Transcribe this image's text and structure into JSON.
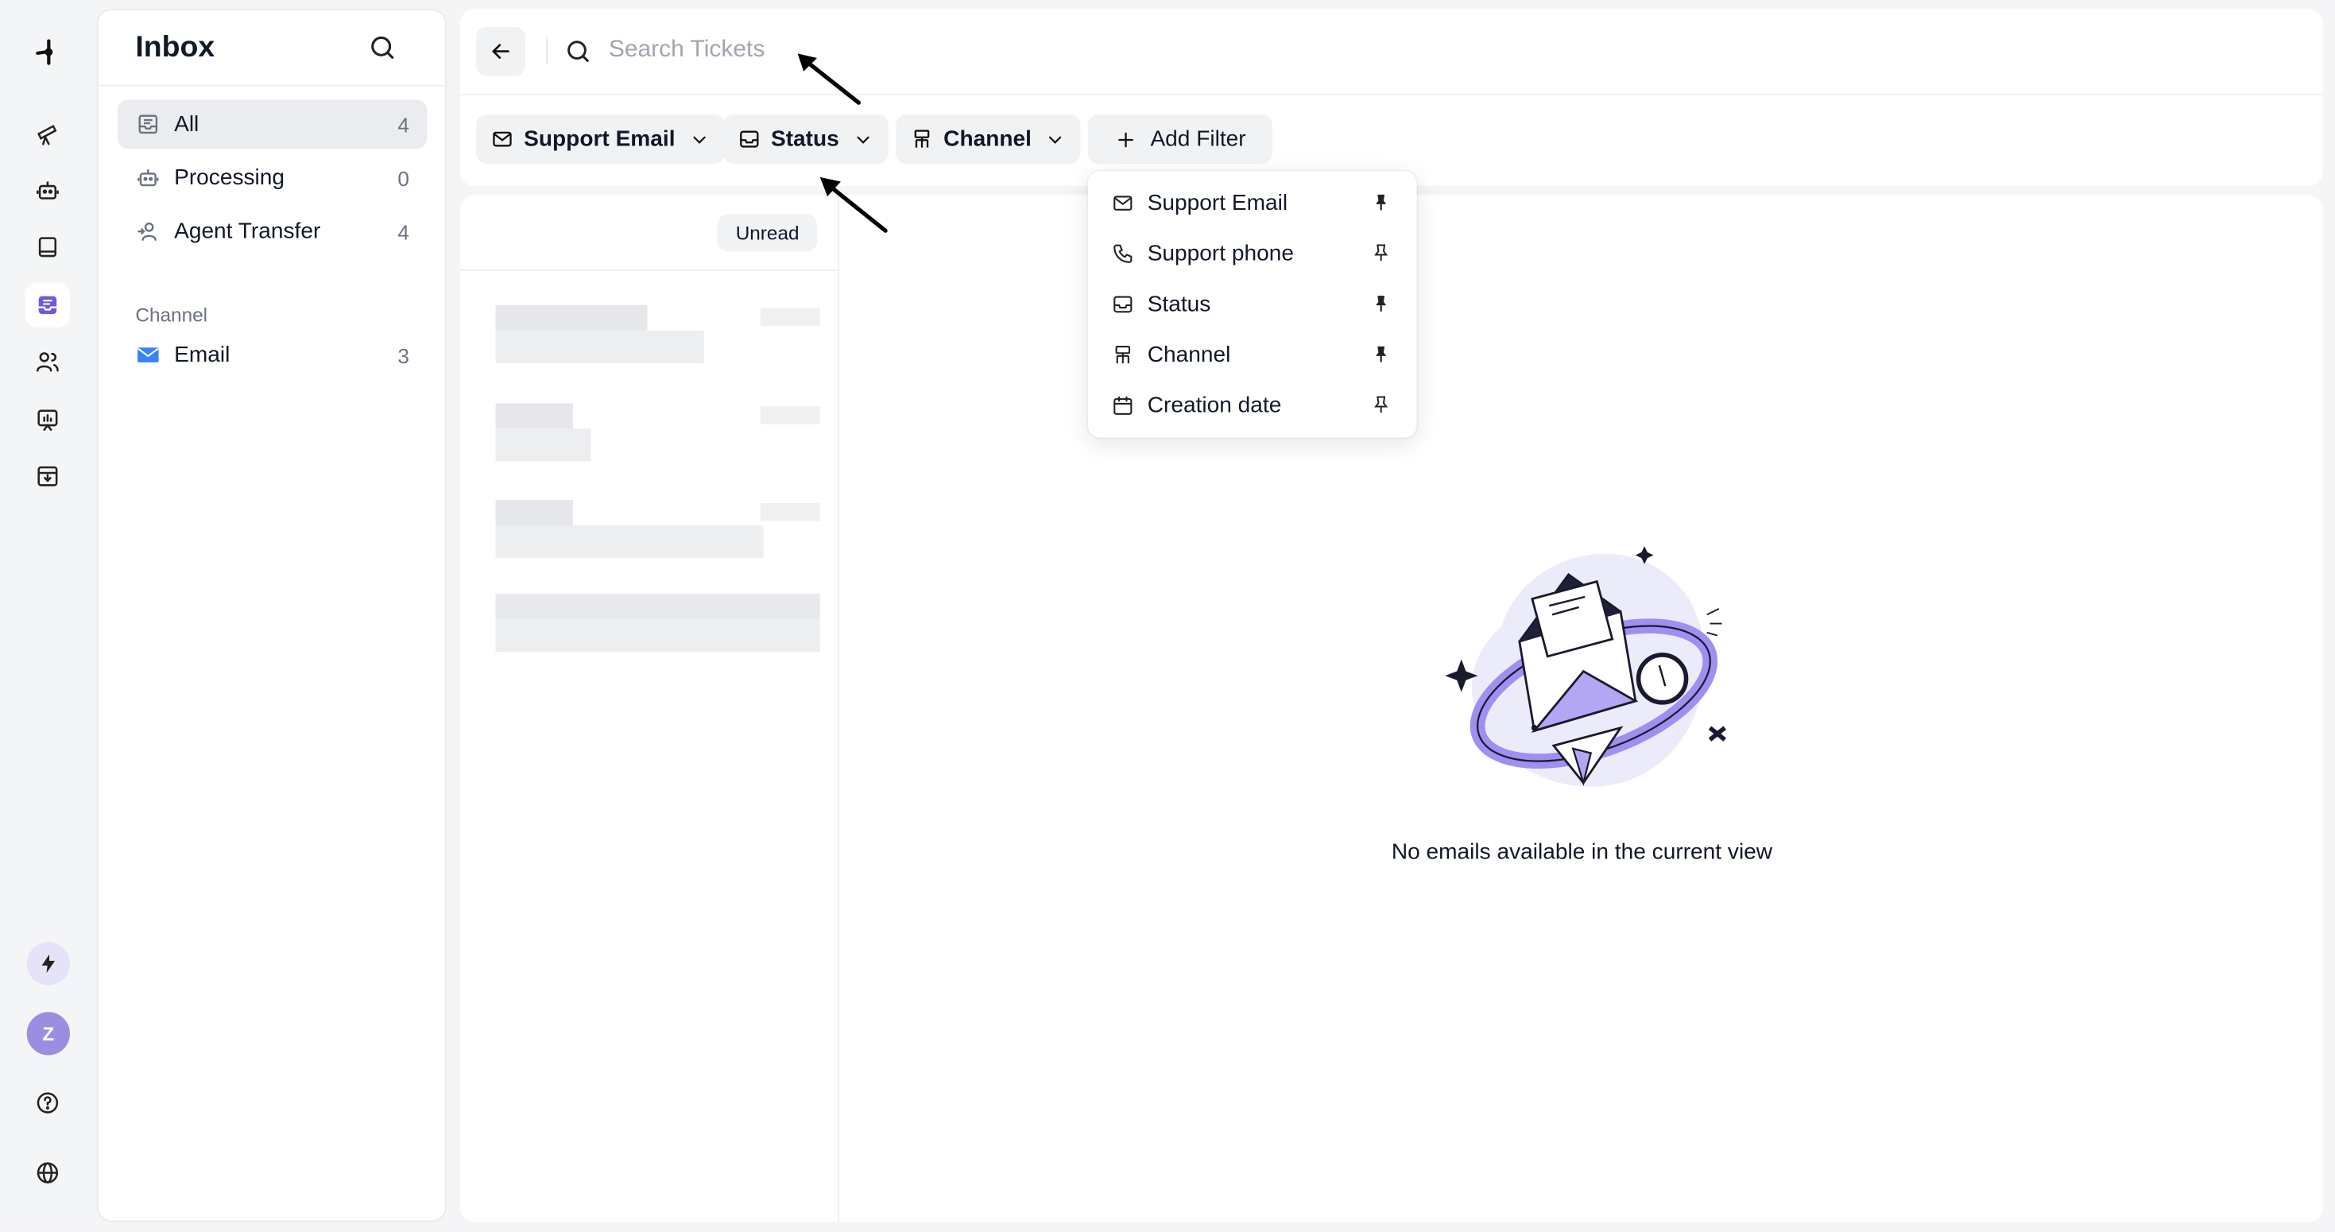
{
  "rail": {
    "avatar_letter": "Z"
  },
  "inbox": {
    "title": "Inbox",
    "items": [
      {
        "label": "All",
        "count": "4"
      },
      {
        "label": "Processing",
        "count": "0"
      },
      {
        "label": "Agent Transfer",
        "count": "4"
      }
    ],
    "channel_section": "Channel",
    "channels": [
      {
        "label": "Email",
        "count": "3"
      }
    ]
  },
  "search": {
    "placeholder": "Search Tickets"
  },
  "filters": [
    {
      "label": "Support Email"
    },
    {
      "label": "Status"
    },
    {
      "label": "Channel"
    }
  ],
  "add_filter": "Add Filter",
  "list": {
    "unread_label": "Unread"
  },
  "empty": {
    "message": "No emails available in the current view"
  },
  "dropdown": {
    "items": [
      {
        "label": "Support Email",
        "icon": "mail-icon",
        "pinned": true
      },
      {
        "label": "Support phone",
        "icon": "phone-icon",
        "pinned": false
      },
      {
        "label": "Status",
        "icon": "inbox-icon",
        "pinned": true
      },
      {
        "label": "Channel",
        "icon": "channel-icon",
        "pinned": true
      },
      {
        "label": "Creation date",
        "icon": "calendar-icon",
        "pinned": false
      }
    ]
  },
  "colors": {
    "accent": "#6c5dd3",
    "avatar": "#9b8ee0",
    "email_icon": "#3b82f6"
  }
}
